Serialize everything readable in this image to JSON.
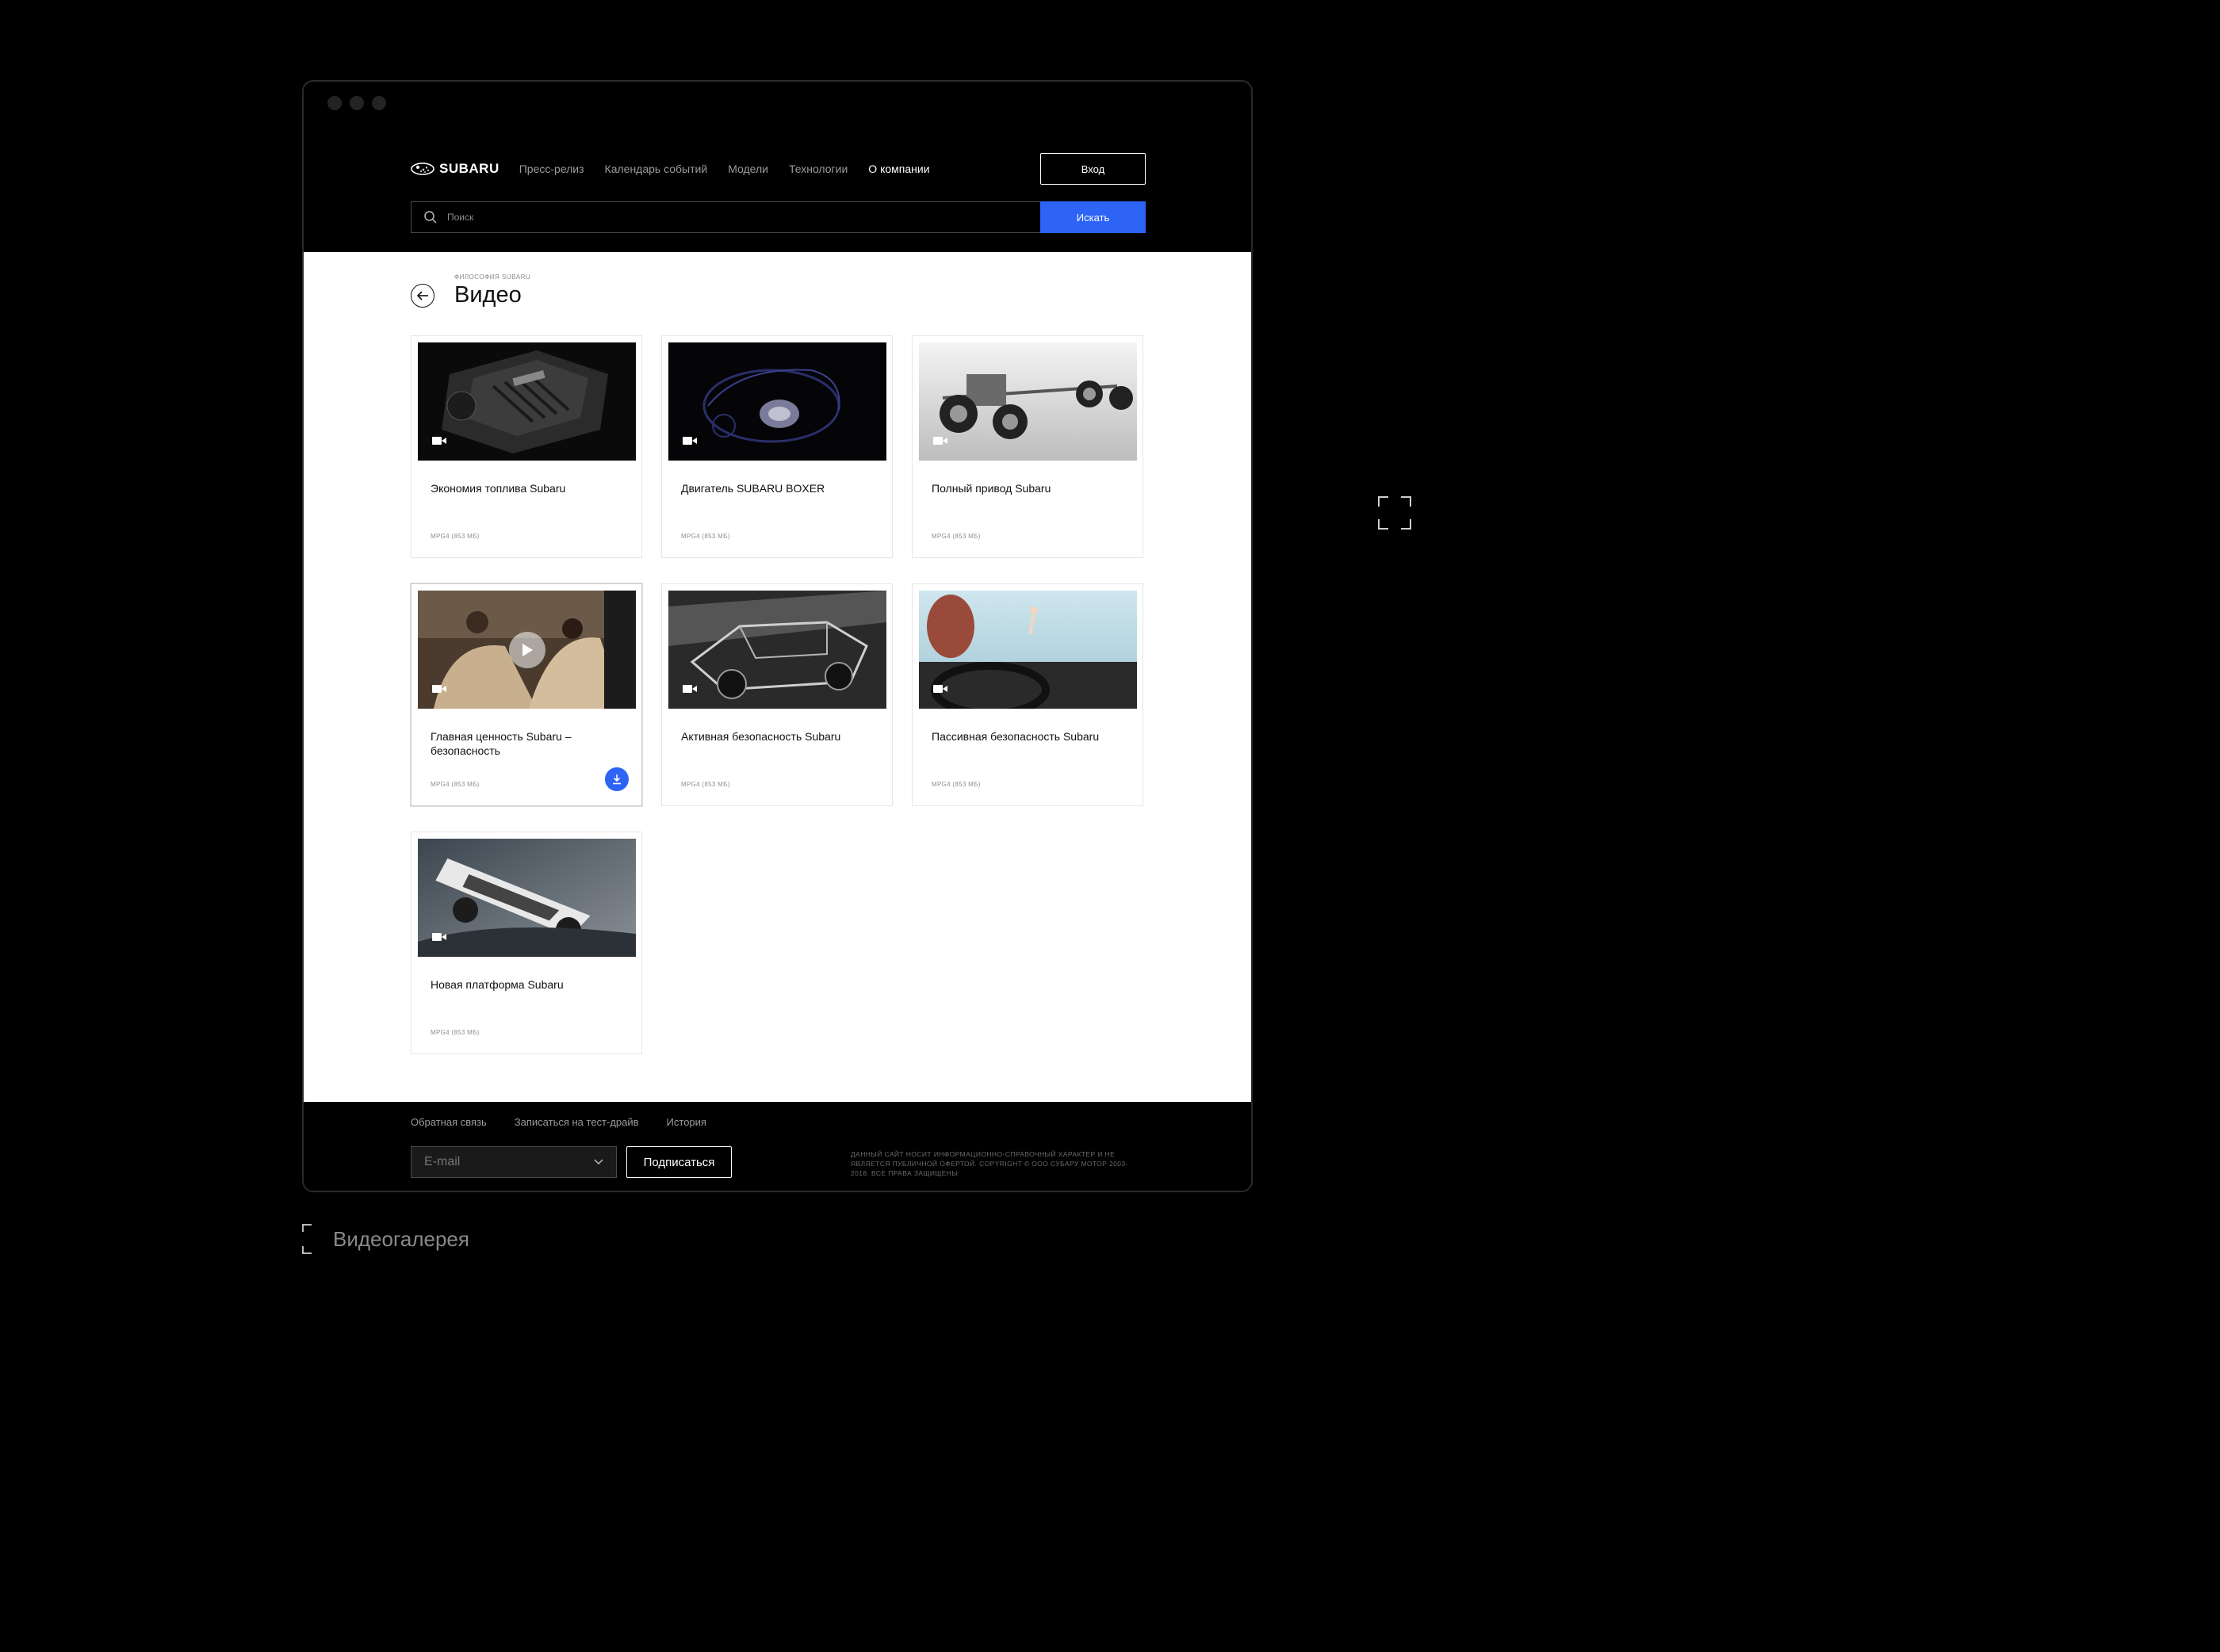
{
  "header": {
    "brand": "SUBARU",
    "nav": [
      {
        "label": "Пресс-релиз",
        "active": false
      },
      {
        "label": "Календарь событий",
        "active": false
      },
      {
        "label": "Модели",
        "active": false
      },
      {
        "label": "Технологии",
        "active": false
      },
      {
        "label": "О компании",
        "active": true
      }
    ],
    "login_label": "Вход",
    "search_placeholder": "Поиск",
    "search_button": "Искать"
  },
  "page": {
    "breadcrumb": "ФИЛОСОФИЯ SUBARU",
    "title": "Видео"
  },
  "videos": [
    {
      "title": "Экономия топлива Subaru",
      "meta": "MPG4 (853 МБ)"
    },
    {
      "title": "Двигатель SUBARU BOXER",
      "meta": "MPG4 (853 МБ)"
    },
    {
      "title": "Полный привод Subaru",
      "meta": "MPG4 (853 МБ)"
    },
    {
      "title": "Главная ценность Subaru – безопасность",
      "meta": "MPG4 (853 МБ)"
    },
    {
      "title": "Активная безопасность Subaru",
      "meta": "MPG4 (853 МБ)"
    },
    {
      "title": "Пассивная безопасность Subaru",
      "meta": "MPG4 (853 МБ)"
    },
    {
      "title": "Новая платформа Subaru",
      "meta": "MPG4 (853 МБ)"
    }
  ],
  "footer": {
    "links": [
      "Обратная связь",
      "Записаться на тест-драйв",
      "История"
    ],
    "email_placeholder": "E-mail",
    "subscribe_label": "Подписаться",
    "legal": "Данный сайт носит информационно-справочный характер и не является публичной офертой. Copyright © ООО Субару Мотор 2003-2018. Все права защищены"
  },
  "caption": "Видеогалерея",
  "colors": {
    "accent": "#2d64f5",
    "background": "#000000",
    "content_bg": "#ffffff"
  }
}
